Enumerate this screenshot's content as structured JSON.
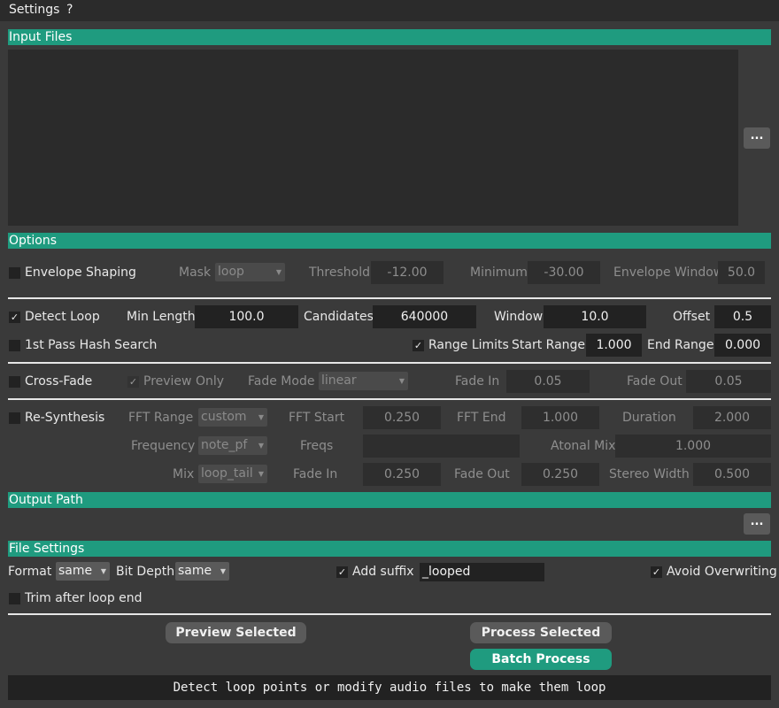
{
  "menu": {
    "settings": "Settings",
    "help": "?"
  },
  "sections": {
    "input_files": "Input Files",
    "options": "Options",
    "output_path": "Output Path",
    "file_settings": "File Settings"
  },
  "browse_label": "...",
  "envelope": {
    "label": "Envelope Shaping",
    "checked": false,
    "mask_label": "Mask",
    "mask_value": "loop",
    "threshold_label": "Threshold",
    "threshold_value": "-12.00",
    "minimum_label": "Minimum",
    "minimum_value": "-30.00",
    "window_label": "Envelope Window",
    "window_value": "50.0"
  },
  "detect": {
    "label": "Detect Loop",
    "checked": true,
    "min_length_label": "Min Length",
    "min_length_value": "100.0",
    "candidates_label": "Candidates",
    "candidates_value": "640000",
    "window_label": "Window",
    "window_value": "10.0",
    "offset_label": "Offset",
    "offset_value": "0.5",
    "hash_label": "1st Pass Hash Search",
    "hash_checked": false,
    "range_limits_label": "Range Limits",
    "range_limits_checked": true,
    "start_range_label": "Start Range",
    "start_range_value": "1.000",
    "end_range_label": "End Range",
    "end_range_value": "0.000"
  },
  "crossfade": {
    "label": "Cross-Fade",
    "checked": false,
    "preview_only_label": "Preview Only",
    "preview_only_checked": true,
    "fade_mode_label": "Fade Mode",
    "fade_mode_value": "linear",
    "fade_in_label": "Fade In",
    "fade_in_value": "0.05",
    "fade_out_label": "Fade Out",
    "fade_out_value": "0.05"
  },
  "resynth": {
    "label": "Re-Synthesis",
    "checked": false,
    "fft_range_label": "FFT Range",
    "fft_range_value": "custom",
    "fft_start_label": "FFT Start",
    "fft_start_value": "0.250",
    "fft_end_label": "FFT End",
    "fft_end_value": "1.000",
    "duration_label": "Duration",
    "duration_value": "2.000",
    "frequency_label": "Frequency",
    "frequency_value": "note_pf",
    "freqs_label": "Freqs",
    "freqs_value": "",
    "atonal_mix_label": "Atonal Mix",
    "atonal_mix_value": "1.000",
    "mix_label": "Mix",
    "mix_value": "loop_tail",
    "fade_in_label": "Fade In",
    "fade_in_value": "0.250",
    "fade_out_label": "Fade Out",
    "fade_out_value": "0.250",
    "stereo_width_label": "Stereo Width",
    "stereo_width_value": "0.500"
  },
  "file_settings": {
    "format_label": "Format",
    "format_value": "same",
    "bit_depth_label": "Bit Depth",
    "bit_depth_value": "same",
    "add_suffix_label": "Add suffix",
    "add_suffix_checked": true,
    "suffix_value": "_looped",
    "avoid_overwriting_label": "Avoid Overwriting",
    "avoid_overwriting_checked": true,
    "trim_label": "Trim after loop end",
    "trim_checked": false
  },
  "actions": {
    "preview_selected": "Preview Selected",
    "process_selected": "Process Selected",
    "batch_process": "Batch Process"
  },
  "status": "Detect loop points or modify audio files to make them loop",
  "icons": {
    "checkmark": "checkmark-icon",
    "dropdown": "chevron-down-icon"
  },
  "colors": {
    "accent": "#1f9b7f",
    "background": "#3a3a3a",
    "field": "#222222"
  }
}
